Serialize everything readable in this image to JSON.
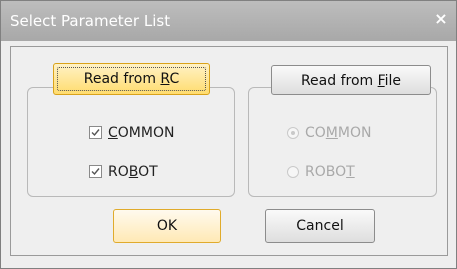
{
  "dialog": {
    "title": "Select Parameter List",
    "close_glyph": "×"
  },
  "rc_group": {
    "button": {
      "pre": "Read from ",
      "mnemonic": "R",
      "post": "C"
    },
    "items": [
      {
        "pre": "",
        "mnemonic": "C",
        "post": "OMMON",
        "checked": true
      },
      {
        "pre": "RO",
        "mnemonic": "B",
        "post": "OT",
        "checked": true
      }
    ]
  },
  "file_group": {
    "button": {
      "pre": "Read from ",
      "mnemonic": "F",
      "post": "ile"
    },
    "items": [
      {
        "pre": "CO",
        "mnemonic": "M",
        "post": "MON",
        "selected": true,
        "enabled": false
      },
      {
        "pre": "ROBO",
        "mnemonic": "T",
        "post": "",
        "selected": false,
        "enabled": false
      }
    ]
  },
  "actions": {
    "ok": "OK",
    "cancel": "Cancel"
  },
  "colors": {
    "accent": "#ffdc6e",
    "title_bar": "#a8a8a8",
    "disabled_text": "#a9a9a9"
  }
}
